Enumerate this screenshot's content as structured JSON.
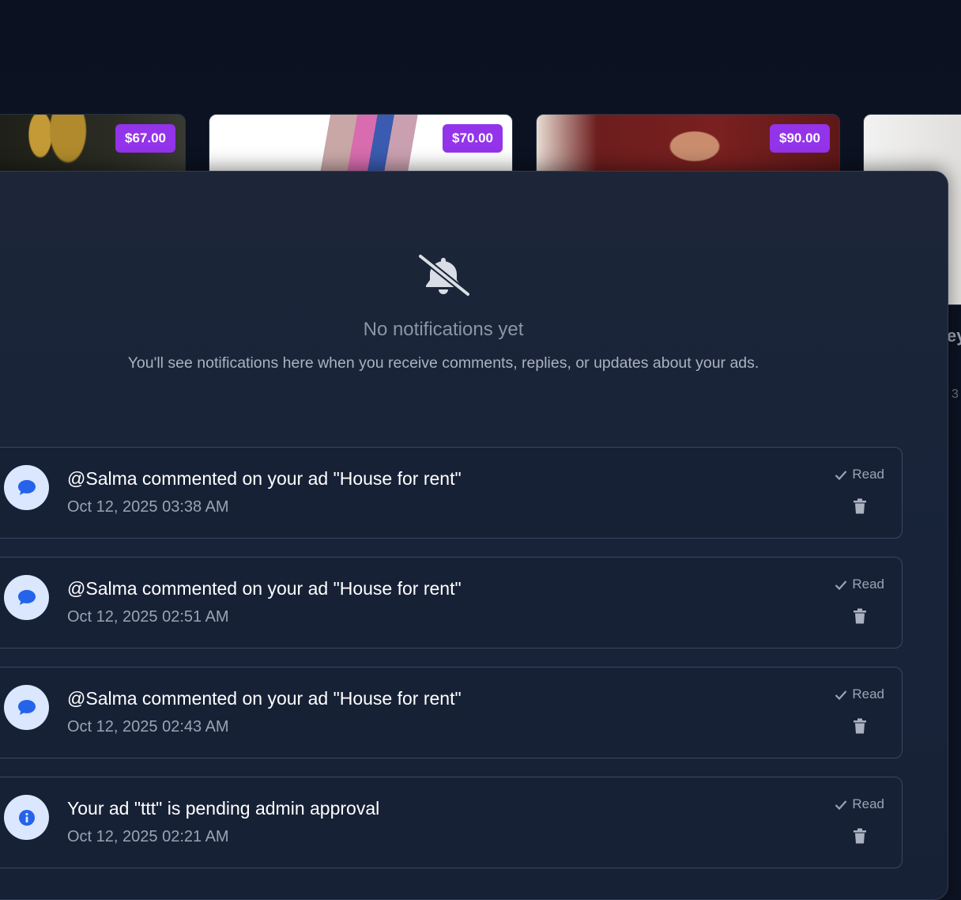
{
  "products": [
    {
      "price": "$67.00"
    },
    {
      "price": "$70.00"
    },
    {
      "price": "$90.00"
    }
  ],
  "peek": {
    "title": "ey",
    "count": "3"
  },
  "empty_state": {
    "icon": "bell-slash-icon",
    "title": "No notifications yet",
    "subtitle": "You'll see notifications here when you receive comments, replies, or updates about your ads."
  },
  "notifications": [
    {
      "icon": "comment-icon",
      "message": "@Salma commented on your ad \"House for rent\"",
      "time": "Oct 12, 2025 03:38 AM",
      "read_label": "Read"
    },
    {
      "icon": "comment-icon",
      "message": "@Salma commented on your ad \"House for rent\"",
      "time": "Oct 12, 2025 02:51 AM",
      "read_label": "Read"
    },
    {
      "icon": "comment-icon",
      "message": "@Salma commented on your ad \"House for rent\"",
      "time": "Oct 12, 2025 02:43 AM",
      "read_label": "Read"
    },
    {
      "icon": "info-icon",
      "message": "Your ad \"ttt\" is pending admin approval",
      "time": "Oct 12, 2025 02:21 AM",
      "read_label": "Read"
    }
  ],
  "colors": {
    "price_badge": "#9333ea",
    "accent_icon": "#2563eb",
    "avatar_bg": "#dbe7ff"
  }
}
